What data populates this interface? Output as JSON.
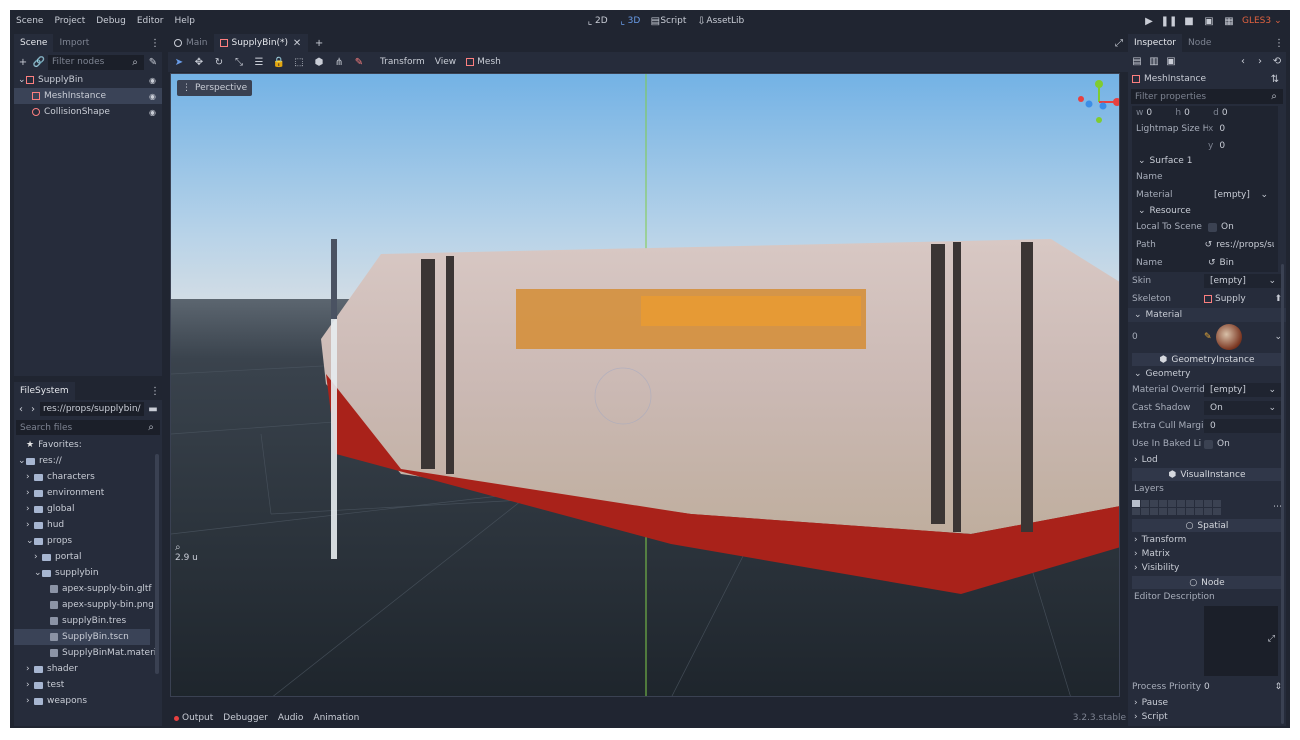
{
  "menu": {
    "items": [
      "Scene",
      "Project",
      "Debug",
      "Editor",
      "Help"
    ]
  },
  "workspaces": {
    "btn2d": "2D",
    "btn3d": "3D",
    "script": "Script",
    "assetlib": "AssetLib"
  },
  "renderer": "GLES3",
  "scene_dock": {
    "tabs": [
      "Scene",
      "Import"
    ],
    "filter_placeholder": "Filter nodes",
    "nodes": [
      {
        "name": "SupplyBin",
        "selected": false
      },
      {
        "name": "MeshInstance",
        "selected": true
      },
      {
        "name": "CollisionShape",
        "selected": false
      }
    ]
  },
  "filesystem": {
    "tab": "FileSystem",
    "path": "res://props/supplybin/S",
    "search_placeholder": "Search files",
    "favorites": "Favorites:",
    "root": "res://",
    "entries": [
      {
        "name": "characters",
        "kind": "folder",
        "indent": 1
      },
      {
        "name": "environment",
        "kind": "folder",
        "indent": 1
      },
      {
        "name": "global",
        "kind": "folder",
        "indent": 1
      },
      {
        "name": "hud",
        "kind": "folder",
        "indent": 1
      },
      {
        "name": "props",
        "kind": "folder",
        "indent": 1
      },
      {
        "name": "portal",
        "kind": "folder",
        "indent": 2
      },
      {
        "name": "supplybin",
        "kind": "folder",
        "indent": 2
      },
      {
        "name": "apex-supply-bin.gltf",
        "kind": "file",
        "indent": 3
      },
      {
        "name": "apex-supply-bin.png",
        "kind": "file",
        "indent": 3
      },
      {
        "name": "supplyBin.tres",
        "kind": "file",
        "indent": 3
      },
      {
        "name": "SupplyBin.tscn",
        "kind": "file",
        "indent": 3,
        "selected": true
      },
      {
        "name": "SupplyBinMat.materi",
        "kind": "file",
        "indent": 3
      },
      {
        "name": "shader",
        "kind": "folder",
        "indent": 1
      },
      {
        "name": "test",
        "kind": "folder",
        "indent": 1
      },
      {
        "name": "weapons",
        "kind": "folder",
        "indent": 1
      }
    ]
  },
  "editor_tabs": [
    {
      "label": "Main",
      "active": false
    },
    {
      "label": "SupplyBin(*)",
      "active": true
    }
  ],
  "toolbar": {
    "transform": "Transform",
    "view": "View",
    "mesh": "Mesh"
  },
  "viewport": {
    "perspective": "Perspective",
    "zoom": "2.9 u"
  },
  "bottom_bar": {
    "tabs": [
      "Output",
      "Debugger",
      "Audio",
      "Animation"
    ],
    "version": "3.2.3.stable"
  },
  "inspector": {
    "tabs": [
      "Inspector",
      "Node"
    ],
    "node_type": "MeshInstance",
    "filter_placeholder": "Filter properties",
    "whd": {
      "w": "0",
      "h": "0",
      "d": "0"
    },
    "lightmap_label": "Lightmap Size Hi",
    "lightmap_x": "0",
    "lightmap_y": "0",
    "surface": "Surface 1",
    "name_label": "Name",
    "material_label": "Material",
    "material_value": "[empty]",
    "resource": "Resource",
    "local_to_scene": "Local To Scene",
    "local_to_scene_value": "On",
    "path_label": "Path",
    "path_value": "res://props/su",
    "name2_label": "Name",
    "name2_value": "Bin",
    "skin_label": "Skin",
    "skin_value": "[empty]",
    "skeleton_label": "Skeleton",
    "skeleton_value": "Supply",
    "material_section": "Material",
    "material_index": "0",
    "geometry_instance": "GeometryInstance",
    "geometry": "Geometry",
    "material_override_label": "Material Overrid",
    "material_override_value": "[empty]",
    "cast_shadow_label": "Cast Shadow",
    "cast_shadow_value": "On",
    "extra_cull_label": "Extra Cull Margi",
    "extra_cull_value": "0",
    "use_baked_label": "Use In Baked Li",
    "use_baked_value": "On",
    "lod": "Lod",
    "visual_instance": "VisualInstance",
    "layers": "Layers",
    "spatial": "Spatial",
    "transform": "Transform",
    "matrix": "Matrix",
    "visibility": "Visibility",
    "node": "Node",
    "editor_description": "Editor Description",
    "process_priority_label": "Process Priority",
    "process_priority_value": "0",
    "pause": "Pause",
    "script": "Script"
  },
  "colors": {
    "accent": "#699ce8",
    "bg": "#202531",
    "panel": "#262c3b",
    "selection": "#3a4357",
    "node_icon": "#fc7f7f"
  }
}
